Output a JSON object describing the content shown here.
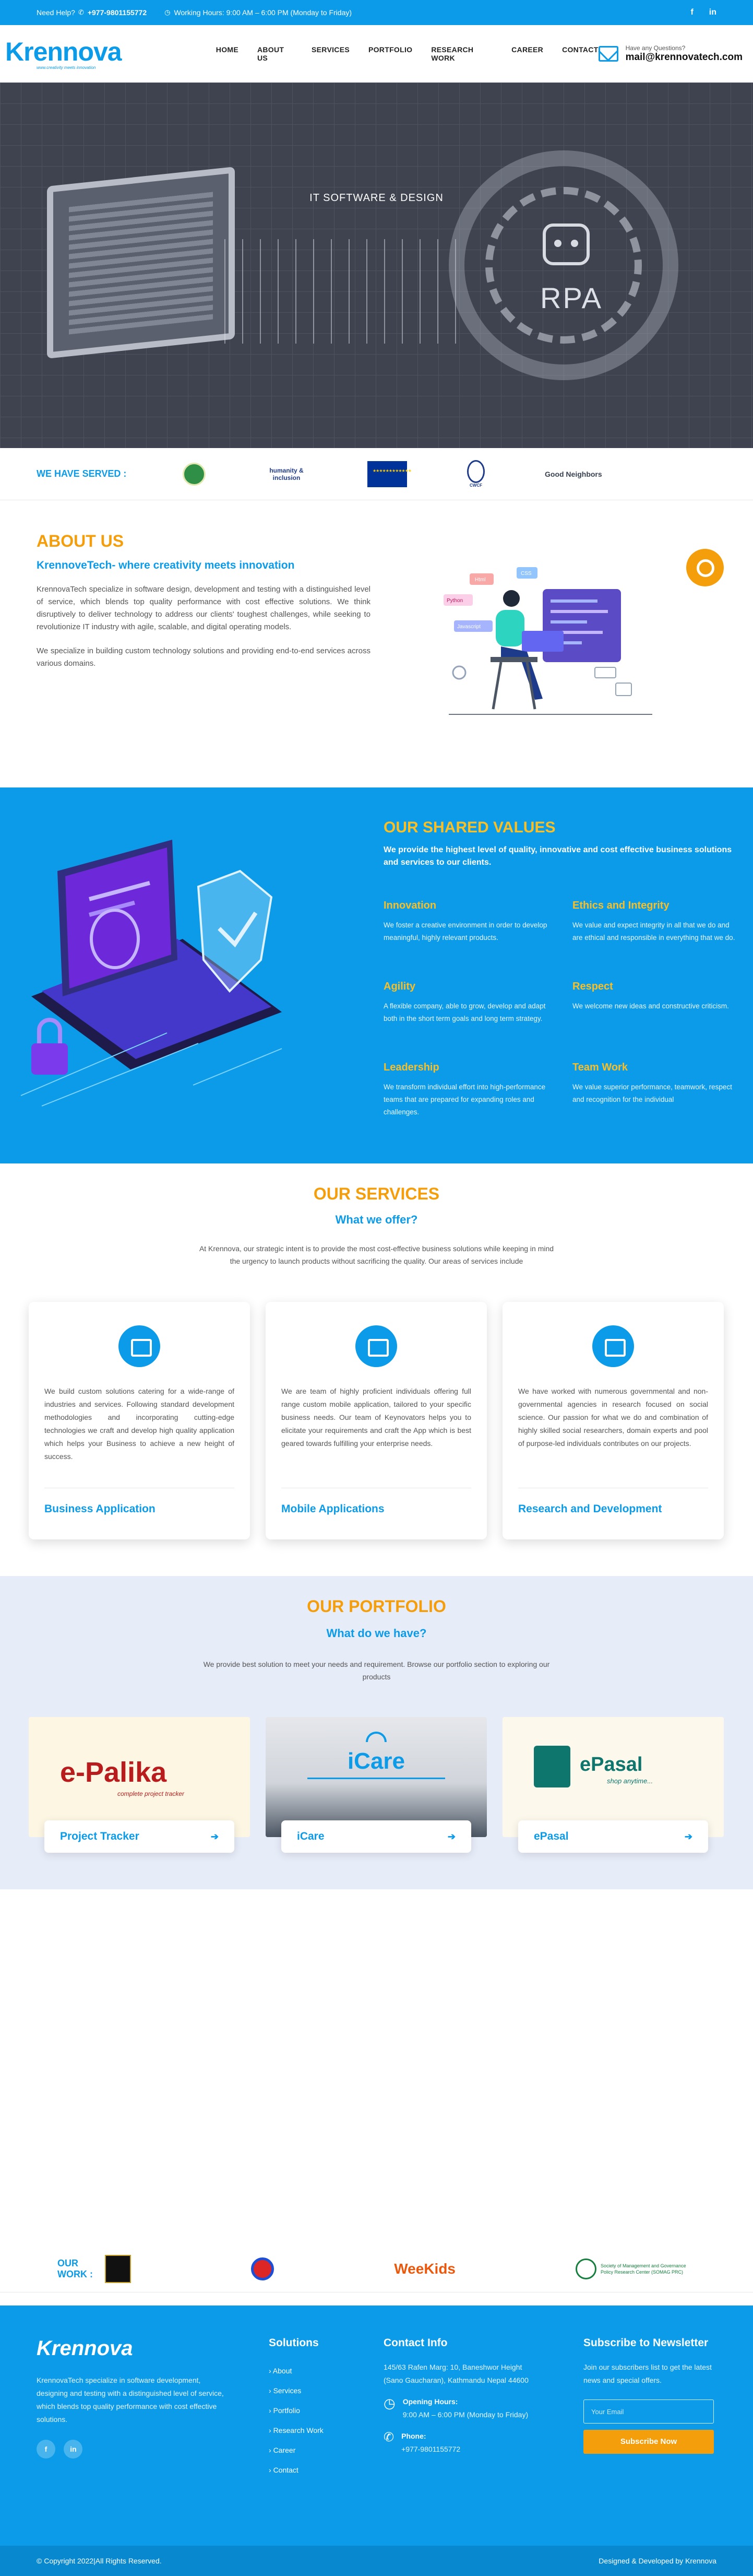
{
  "topbar": {
    "need_help": "Need Help?",
    "phone": "+977-9801155772",
    "hours": "Working Hours: 9:00 AM – 6:00 PM (Monday to Friday)",
    "social": [
      "f",
      "in"
    ]
  },
  "brand": {
    "name": "Krennova",
    "tagline": "www.creativity meets innovation"
  },
  "nav": [
    "HOME",
    "ABOUT US",
    "SERVICES",
    "PORTFOLIO",
    "RESEARCH WORK",
    "CAREER",
    "CONTACT"
  ],
  "header_contact": {
    "question": "Have any Questions?",
    "email": "mail@krennovatech.com"
  },
  "hero": {
    "caption": "IT SOFTWARE & DESIGN",
    "rpa_text": "RPA"
  },
  "served": {
    "label": "WE HAVE SERVED :",
    "logos": [
      "",
      "humanity & inclusion",
      "",
      "CWCF",
      "Good Neighbors"
    ]
  },
  "about": {
    "title": "ABOUT US",
    "subtitle": "KrennoveTech- where creativity meets innovation",
    "p1": "KrennovaTech specialize in software design, development and testing with a distinguished level of service, which blends top quality performance with cost effective solutions. We think disruptively to deliver technology to address our clients' toughest challenges, while seeking to revolutionize IT industry with agile, scalable, and digital operating models.",
    "p2": "We specialize in building custom technology solutions and providing end-to-end services across various domains.",
    "tags": [
      "Html",
      "CSS",
      "Python",
      "Javascript"
    ]
  },
  "values": {
    "title": "OUR SHARED VALUES",
    "subtitle": "We provide the highest level of quality, innovative and cost effective business solutions and services to our clients.",
    "items": [
      {
        "title": "Innovation",
        "text": "We foster a creative environment in order to develop meaningful, highly relevant products."
      },
      {
        "title": "Ethics and Integrity",
        "text": "We value and expect integrity in all that we do and are ethical and responsible in everything that we do."
      },
      {
        "title": "Agility",
        "text": "A flexible company, able to grow, develop and adapt both in the short term goals and long term strategy."
      },
      {
        "title": "Respect",
        "text": "We welcome new ideas and constructive criticism."
      },
      {
        "title": "Leadership",
        "text": "We transform individual effort into high-performance teams that are prepared for expanding roles and challenges."
      },
      {
        "title": "Team Work",
        "text": "We value superior performance, teamwork, respect and recognition for the individual"
      }
    ]
  },
  "services": {
    "title": "OUR SERVICES",
    "subtitle": "What we offer?",
    "intro": "At Krennova, our strategic intent is to provide the most cost-effective business solutions while keeping in mind the urgency to launch products without sacrificing the quality. Our areas of services include",
    "cards": [
      {
        "text": "We build custom solutions catering for a wide-range of industries and services. Following standard development methodologies and incorporating cutting-edge technologies we craft and develop high quality application which helps your Business to achieve a new height of success.",
        "title": "Business Application"
      },
      {
        "text": "We are team of highly proficient individuals offering full range custom mobile application, tailored to your specific business needs. Our team of Keynovators helps you to elicitate your requirements and craft the App which is best geared towards fulfilling your enterprise needs.",
        "title": "Mobile Applications"
      },
      {
        "text": "We have worked with numerous governmental and non-governmental agencies in research focused on social science. Our passion for what we do and combination of highly skilled social researchers, domain experts and pool of purpose-led individuals contributes on our projects.",
        "title": "Research and Development"
      }
    ]
  },
  "portfolio": {
    "title": "OUR PORTFOLIO",
    "subtitle": "What do we have?",
    "intro": "We provide best solution to meet your needs and requirement. Browse our portfolio section to exploring our products",
    "items": [
      {
        "image_text": "e-Palika",
        "image_sub": "complete project tracker",
        "title": "Project Tracker"
      },
      {
        "image_text": "iCare",
        "image_sub": "",
        "title": "iCare"
      },
      {
        "image_text": "ePasal",
        "image_sub": "shop anytime...",
        "title": "ePasal"
      }
    ]
  },
  "work": {
    "label": "OUR WORK :",
    "logos": [
      "",
      "",
      "WeeKids",
      "Society of Management and Governance Policy Research Center (SOMAG PRC)"
    ]
  },
  "footer": {
    "brand": "Krennova",
    "about": "KrennovaTech specialize in software development, designing and testing with a distinguished level of service, which blends top quality performance with cost effective solutions.",
    "social": [
      "f",
      "in"
    ],
    "solutions_title": "Solutions",
    "solutions": [
      "About",
      "Services",
      "Portfolio",
      "Research Work",
      "Career",
      "Contact"
    ],
    "contact_title": "Contact Info",
    "address": "145/63 Rafen Marg: 10, Baneshwor Height (Sano Gaucharan), Kathmandu Nepal 44600",
    "hours_label": "Opening Hours:",
    "hours": "9:00 AM – 6:00 PM (Monday to Friday)",
    "phone_label": "Phone:",
    "phone": "+977-9801155772",
    "newsletter_title": "Subscribe to Newsletter",
    "newsletter_text": "Join our subscribers list to get the latest news and special offers.",
    "email_placeholder": "Your Email",
    "subscribe": "Subscribe Now"
  },
  "bottom": {
    "copyright": "© Copyright 2022|All Rights Reserved.",
    "credit": "Designed & Developed by Krennova"
  },
  "colors": {
    "primary": "#0b9be8",
    "accent": "#f59e0b"
  }
}
